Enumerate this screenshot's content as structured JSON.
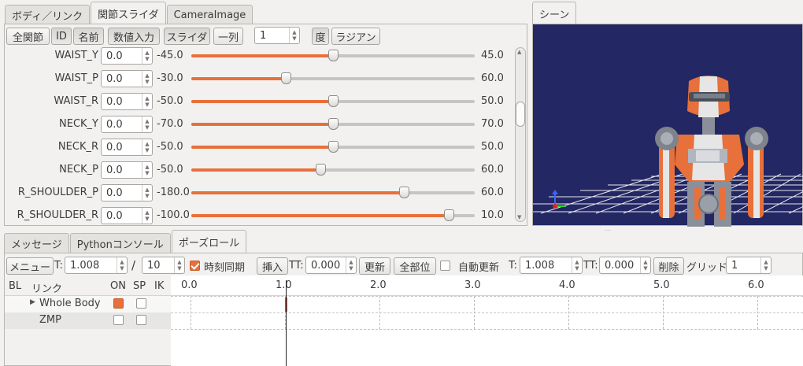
{
  "left_tabs": [
    {
      "label": "ボディ／リンク",
      "active": false
    },
    {
      "label": "関節スライダ",
      "active": true
    },
    {
      "label": "CameraImage",
      "active": false
    }
  ],
  "scene_tab": {
    "label": "シーン"
  },
  "slider_toolbar": {
    "all_joints": "全関節",
    "id": "ID",
    "name": "名前",
    "numeric_input": "数値入力",
    "slider": "スライダ",
    "one_column": "一列",
    "columns_value": "1",
    "degree": "度",
    "radian": "ラジアン"
  },
  "joints": [
    {
      "name": "WAIST_Y",
      "value": "0.0",
      "min": "-45.0",
      "max": "45.0",
      "fraction": 0.5
    },
    {
      "name": "WAIST_P",
      "value": "0.0",
      "min": "-30.0",
      "max": "60.0",
      "fraction": 0.333
    },
    {
      "name": "WAIST_R",
      "value": "0.0",
      "min": "-50.0",
      "max": "50.0",
      "fraction": 0.5
    },
    {
      "name": "NECK_Y",
      "value": "0.0",
      "min": "-70.0",
      "max": "70.0",
      "fraction": 0.5
    },
    {
      "name": "NECK_R",
      "value": "0.0",
      "min": "-50.0",
      "max": "50.0",
      "fraction": 0.5
    },
    {
      "name": "NECK_P",
      "value": "0.0",
      "min": "-50.0",
      "max": "60.0",
      "fraction": 0.455
    },
    {
      "name": "R_SHOULDER_P",
      "value": "0.0",
      "min": "-180.0",
      "max": "60.0",
      "fraction": 0.75
    },
    {
      "name": "R_SHOULDER_R",
      "value": "0.0",
      "min": "-100.0",
      "max": "10.0",
      "fraction": 0.909
    }
  ],
  "bottom_tabs": [
    {
      "label": "メッセージ",
      "active": false
    },
    {
      "label": "Pythonコンソール",
      "active": false
    },
    {
      "label": "ポーズロール",
      "active": true
    }
  ],
  "pose_toolbar": {
    "menu": "メニュー",
    "t_label": "T:",
    "time_value": "1.008",
    "slash": "/",
    "total_value": "10",
    "sync_label": "時刻同期",
    "insert": "挿入",
    "tt_label": "TT:",
    "tt_value": "0.000",
    "update": "更新",
    "all_parts": "全部位",
    "auto_update": "自動更新",
    "t2_label": "T:",
    "t2_value": "1.008",
    "tt2_label": "TT:",
    "tt2_value": "0.000",
    "delete": "削除",
    "grid_label": "グリッド:",
    "grid_value": "1"
  },
  "pose_table": {
    "col_bl": "BL",
    "col_link": "リンク",
    "col_on": "ON",
    "col_sp": "SP",
    "col_ik": "IK",
    "rows": [
      {
        "name": "Whole Body",
        "expand": "▶",
        "on": true,
        "sp": false
      },
      {
        "name": "ZMP",
        "on": false,
        "sp": false
      }
    ],
    "ticks": [
      "0.0",
      "1.0",
      "2.0",
      "3.0",
      "4.0",
      "5.0",
      "6.0"
    ]
  },
  "colors": {
    "accent": "#e8703a",
    "scene_bg": "#232763"
  }
}
